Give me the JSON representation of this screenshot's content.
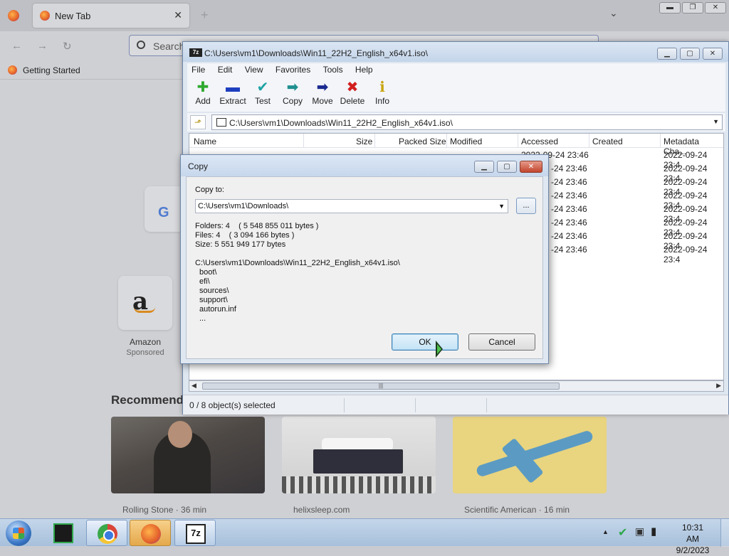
{
  "browser": {
    "tab_title": "New Tab",
    "tab_close": "✕",
    "new_tab": "+",
    "search_placeholder": "Search",
    "bookmark": "Getting Started",
    "shortcut_amazon": "Amazon",
    "shortcut_amazon_sub": "Sponsored",
    "recommended": "Recommended",
    "cards": [
      {
        "source": "Rolling Stone · 36 min"
      },
      {
        "source": "helixsleep.com"
      },
      {
        "source": "Scientific American · 16 min"
      }
    ]
  },
  "zip": {
    "title": "C:\\Users\\vm1\\Downloads\\Win11_22H2_English_x64v1.iso\\",
    "menu": [
      "File",
      "Edit",
      "View",
      "Favorites",
      "Tools",
      "Help"
    ],
    "toolbar": [
      "Add",
      "Extract",
      "Test",
      "Copy",
      "Move",
      "Delete",
      "Info"
    ],
    "address": "C:\\Users\\vm1\\Downloads\\Win11_22H2_English_x64v1.iso\\",
    "columns": [
      "Name",
      "Size",
      "Packed Size",
      "Modified",
      "Accessed",
      "Created",
      "Metadata Cha..."
    ],
    "rows_accessed": [
      "-24 23:46",
      "-24 23:46",
      "-24 23:46",
      "-24 23:46",
      "-24 23:46",
      "-24 23:46",
      "-24 23:46"
    ],
    "rows_metadata": [
      "2022-09-24 23:4",
      "2022-09-24 23:4",
      "2022-09-24 23:4",
      "2022-09-24 23:4",
      "2022-09-24 23:4",
      "2022-09-24 23:4",
      "2022-09-24 23:4",
      "2022-09-24 23:4"
    ],
    "first_row_accessed": "2022-09-24 23:46",
    "status": "0 / 8 object(s) selected"
  },
  "dialog": {
    "title": "Copy",
    "copy_to_label": "Copy to:",
    "copy_to_value": "C:\\Users\\vm1\\Downloads\\",
    "browse": "...",
    "folders": "Folders: 4    ( 5 548 855 011 bytes )",
    "files": "Files: 4    ( 3 094 166 bytes )",
    "size": "Size: 5 551 949 177 bytes",
    "source_path": "C:\\Users\\vm1\\Downloads\\Win11_22H2_English_x64v1.iso\\",
    "items": [
      "boot\\",
      "efi\\",
      "sources\\",
      "support\\",
      "autorun.inf",
      "..."
    ],
    "ok": "OK",
    "cancel": "Cancel"
  },
  "taskbar": {
    "time": "10:31 AM",
    "date": "9/2/2023",
    "seven_zip_label": "7z"
  }
}
